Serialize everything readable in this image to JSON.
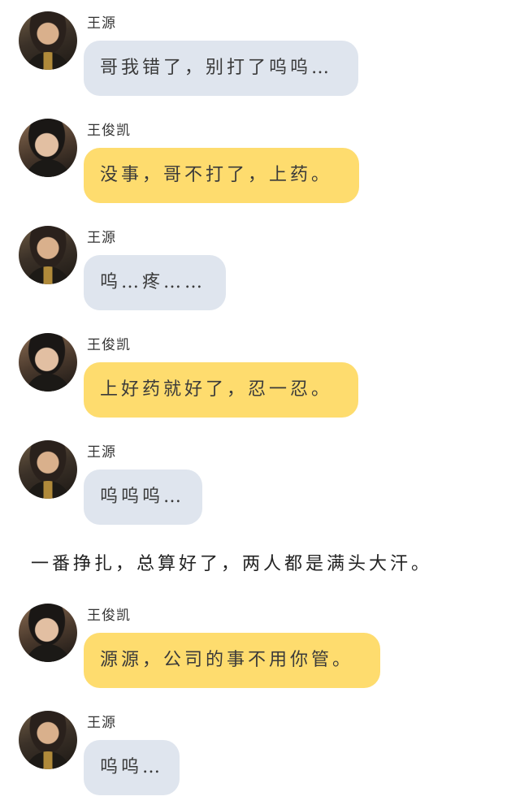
{
  "messages": [
    {
      "speaker": "王源",
      "text": "哥我错了，别打了呜呜…",
      "style": "gray"
    },
    {
      "speaker": "王俊凯",
      "text": "没事，哥不打了，上药。",
      "style": "yellow"
    },
    {
      "speaker": "王源",
      "text": "呜…疼……",
      "style": "gray"
    },
    {
      "speaker": "王俊凯",
      "text": "上好药就好了，忍一忍。",
      "style": "yellow"
    },
    {
      "speaker": "王源",
      "text": "呜呜呜…",
      "style": "gray"
    },
    {
      "speaker": "王俊凯",
      "text": "源源，公司的事不用你管。",
      "style": "yellow"
    },
    {
      "speaker": "王源",
      "text": "呜呜…",
      "style": "gray"
    }
  ],
  "narration": "一番挣扎，总算好了，两人都是满头大汗。",
  "colors": {
    "gray_bubble": "#dfe5ee",
    "yellow_bubble": "#fedc6e",
    "background": "#ffffff"
  }
}
